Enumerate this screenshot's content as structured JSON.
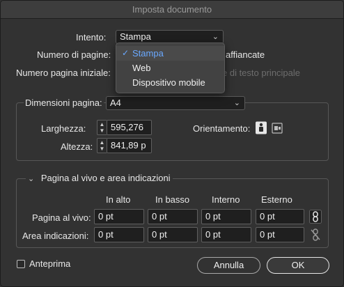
{
  "window": {
    "title": "Imposta documento"
  },
  "intent": {
    "label": "Intento:",
    "value": "Stampa"
  },
  "pages": {
    "label": "Numero di pagine:",
    "facing_label": "affiancate"
  },
  "start_page": {
    "label": "Numero pagina iniziale:",
    "primary_text_label": "e di testo principale"
  },
  "intent_menu": {
    "items": [
      {
        "label": "Stampa",
        "checked": true
      },
      {
        "label": "Web",
        "checked": false
      },
      {
        "label": "Dispositivo mobile",
        "checked": false
      }
    ]
  },
  "page_size": {
    "label": "Dimensioni pagina:",
    "value": "A4",
    "width_label": "Larghezza:",
    "width_value": "595,276",
    "height_label": "Altezza:",
    "height_value": "841,89 p",
    "orientation_label": "Orientamento:"
  },
  "bleed": {
    "section_label": "Pagina al vivo e area indicazioni",
    "columns": [
      "In alto",
      "In basso",
      "Interno",
      "Esterno"
    ],
    "bleed_row": {
      "label": "Pagina al vivo:",
      "values": [
        "0 pt",
        "0 pt",
        "0 pt",
        "0 pt"
      ]
    },
    "slug_row": {
      "label": "Area indicazioni:",
      "values": [
        "0 pt",
        "0 pt",
        "0 pt",
        "0 pt"
      ]
    }
  },
  "footer": {
    "preview_label": "Anteprima",
    "cancel_label": "Annulla",
    "ok_label": "OK"
  },
  "colors": {
    "window_bg": "#323232",
    "field_bg": "#1f1f1f",
    "accent": "#6aa9ff"
  }
}
